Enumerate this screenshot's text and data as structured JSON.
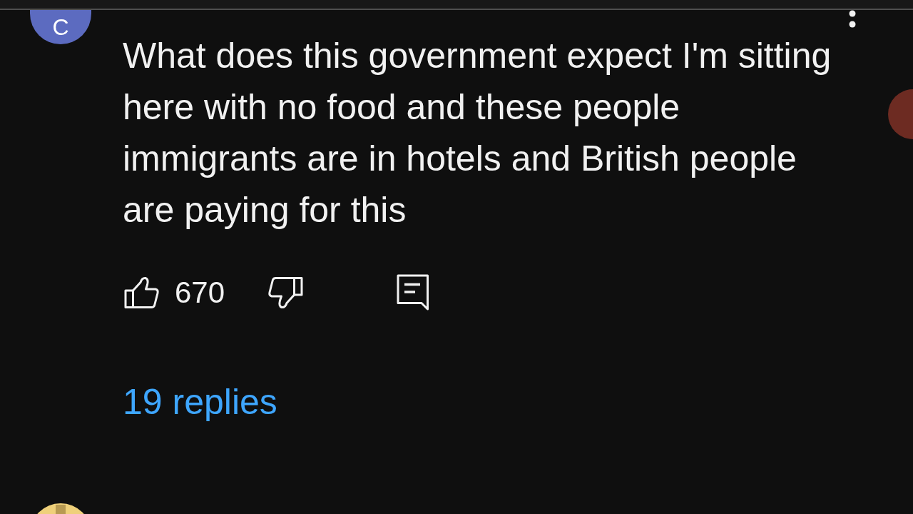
{
  "comment": {
    "avatar_letter": "C",
    "text": "What does this government expect I'm sitting here with no food and these people immigrants are in hotels and British people are paying for this",
    "likes": "670",
    "liked": false,
    "disliked": false,
    "replies": "19 replies"
  }
}
